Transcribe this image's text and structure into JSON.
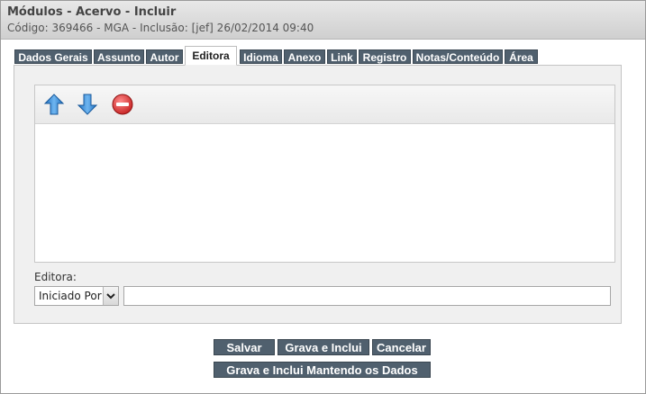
{
  "header": {
    "title": "Módulos - Acervo - Incluir",
    "subtitle": "Código: 369466 - MGA - Inclusão: [jef] 26/02/2014 09:40"
  },
  "tabs": [
    {
      "label": "Dados Gerais",
      "active": false
    },
    {
      "label": "Assunto",
      "active": false
    },
    {
      "label": "Autor",
      "active": false
    },
    {
      "label": "Editora",
      "active": true
    },
    {
      "label": "Idioma",
      "active": false
    },
    {
      "label": "Anexo",
      "active": false
    },
    {
      "label": "Link",
      "active": false
    },
    {
      "label": "Registro",
      "active": false
    },
    {
      "label": "Notas/Conteúdo",
      "active": false
    },
    {
      "label": "Área",
      "active": false
    }
  ],
  "toolbar": {
    "icons": [
      "move-up-icon",
      "move-down-icon",
      "remove-icon"
    ]
  },
  "editora": {
    "label": "Editora:",
    "filter_selected": "Iniciado Por",
    "value": ""
  },
  "buttons": {
    "save": "Salvar",
    "save_and_add": "Grava e Inclui",
    "cancel": "Cancelar",
    "save_and_add_keep": "Grava e Inclui Mantendo os Dados"
  },
  "colors": {
    "tab_bg": "#50606e",
    "button_bg": "#50606e",
    "up_arrow": "#3a8fd8",
    "remove": "#d62f2f"
  }
}
